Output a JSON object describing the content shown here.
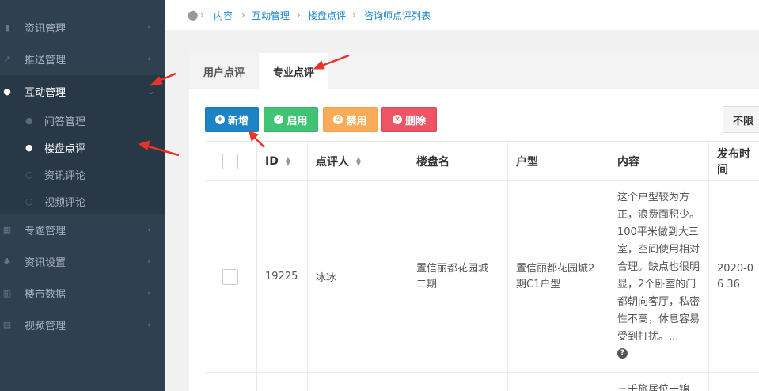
{
  "sidebar": {
    "items": [
      {
        "label": "资讯管理",
        "icon": "file-icon"
      },
      {
        "label": "推送管理",
        "icon": "external-link-icon"
      },
      {
        "label": "互动管理",
        "icon": "comment-icon"
      },
      {
        "label": "专题管理",
        "icon": "grid-icon"
      },
      {
        "label": "资讯设置",
        "icon": "gear-icon"
      },
      {
        "label": "楼市数据",
        "icon": "bar-chart-icon"
      },
      {
        "label": "视频管理",
        "icon": "film-icon"
      }
    ],
    "subitems": [
      {
        "label": "问答管理",
        "icon": "question-circle-icon"
      },
      {
        "label": "楼盘点评",
        "icon": "comments-icon"
      },
      {
        "label": "资讯评论",
        "icon": "comment-outline-icon"
      },
      {
        "label": "视频评论",
        "icon": "comment-outline-icon"
      }
    ]
  },
  "breadcrumb": [
    "内容",
    "互动管理",
    "楼盘点评",
    "咨询师点评列表"
  ],
  "tabs": [
    "用户点评",
    "专业点评"
  ],
  "toolbar": {
    "add": "新增",
    "enable": "启用",
    "disable": "禁用",
    "delete": "删除",
    "filter": "不限"
  },
  "table": {
    "headers": [
      "ID",
      "点评人",
      "楼盘名",
      "户型",
      "内容",
      "发布时间"
    ],
    "rows": [
      {
        "id": "19225",
        "reviewer": "冰冰",
        "estate": "置信丽都花园城二期",
        "layout": "置信丽都花园城2期C1户型",
        "content": "这个户型较为方正，浪费面积少。100平米做到大三室，空间使用相对合理。缺点也很明显，2个卧室的门都朝向客厅，私密性不高，休息容易受到打扰。...",
        "time": "2020-06 36"
      }
    ],
    "next_row_preview": "三千旅居位于锦"
  },
  "colors": {
    "sidebar_bg": "#2f4050",
    "primary": "#1c84c6",
    "success": "#40c474",
    "warning": "#f8ac59",
    "danger": "#ed5565",
    "annotation_arrow": "#e8332a"
  }
}
